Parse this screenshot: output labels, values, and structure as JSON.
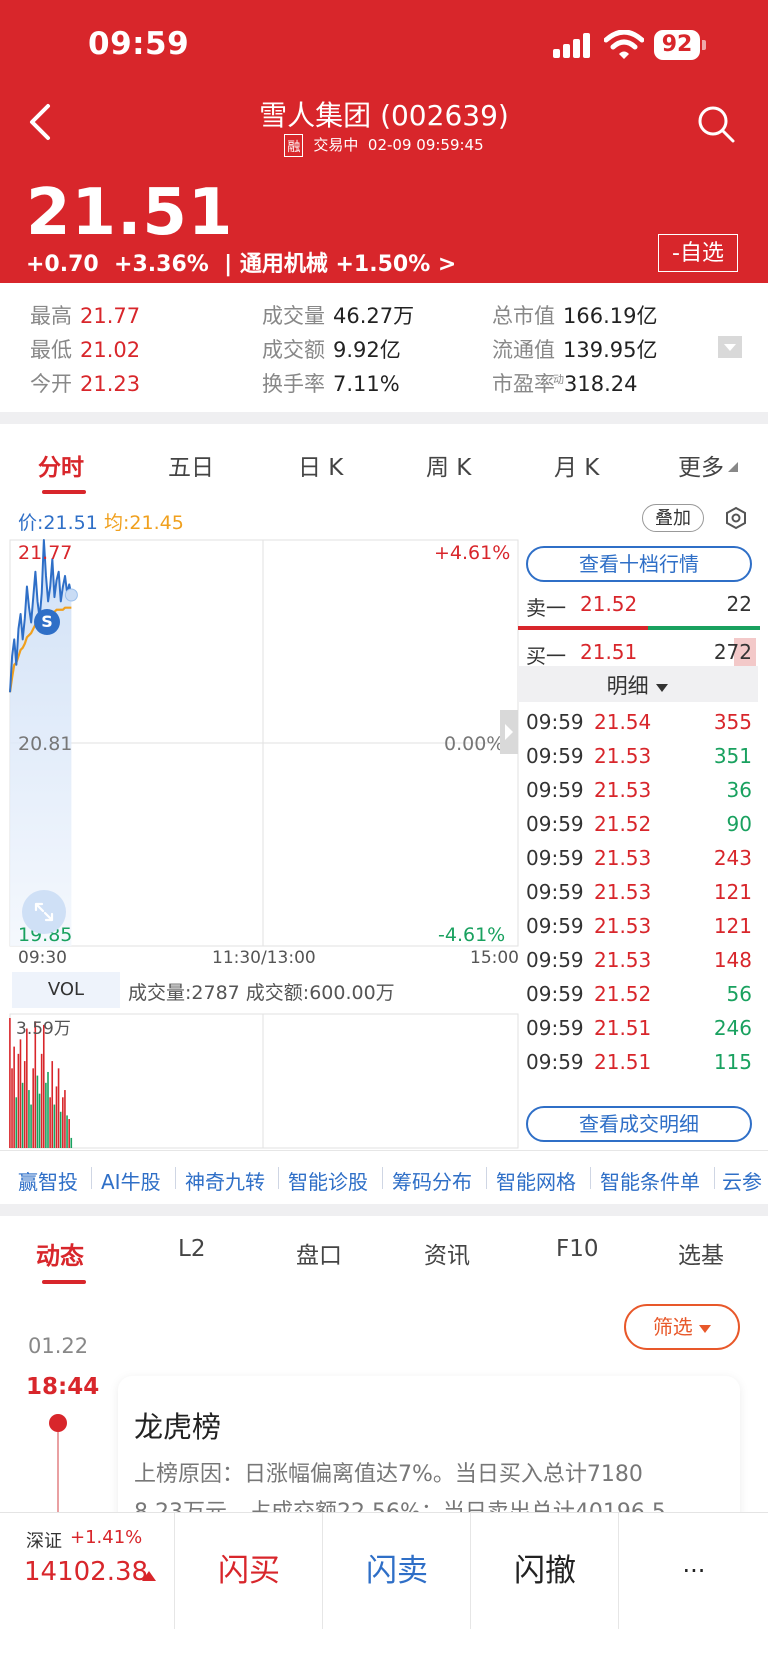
{
  "status_bar": {
    "time": "09:59",
    "battery": "92"
  },
  "header": {
    "title": "雪人集团 (002639)",
    "margin_tag": "融",
    "status": "交易中",
    "timestamp": "02-09 09:59:45",
    "price": "21.51",
    "change": "+0.70",
    "change_pct": "+3.36%",
    "sector": "| 通用机械 +1.50% >",
    "watchlist_label": "-自选"
  },
  "stats": {
    "high_label": "最高",
    "high": "21.77",
    "low_label": "最低",
    "low": "21.02",
    "open_label": "今开",
    "open": "21.23",
    "volume_label": "成交量",
    "volume": "46.27万",
    "amount_label": "成交额",
    "amount": "9.92亿",
    "turnover_label": "换手率",
    "turnover": "7.11%",
    "mktcap_label": "总市值",
    "mktcap": "166.19亿",
    "float_label": "流通值",
    "float": "139.95亿",
    "pe_label": "市盈率",
    "pe_mark": "动",
    "pe": "318.24"
  },
  "chart_tabs": [
    "分时",
    "五日",
    "日 K",
    "周 K",
    "月 K",
    "更多"
  ],
  "chart": {
    "price_label": "价:21.51",
    "avg_label": "均:21.45",
    "overlay_button": "叠加",
    "y_high": "21.77",
    "y_mid": "20.81",
    "y_low": "19.85",
    "pct_high": "+4.61%",
    "pct_mid": "0.00%",
    "pct_low": "-4.61%",
    "x_start": "09:30",
    "x_mid": "11:30/13:00",
    "x_end": "15:00",
    "s_marker": "S",
    "vol_tab": "VOL",
    "vol_info": "成交量:2787 成交额:600.00万",
    "vol_max": "3.59万"
  },
  "chart_data": {
    "type": "line",
    "title": "",
    "x": [
      "09:30",
      "09:31",
      "09:32",
      "09:33",
      "09:34",
      "09:35",
      "09:36",
      "09:37",
      "09:38",
      "09:39",
      "09:40",
      "09:41",
      "09:42",
      "09:43",
      "09:44",
      "09:45",
      "09:46",
      "09:47",
      "09:48",
      "09:49",
      "09:50",
      "09:51",
      "09:52",
      "09:53",
      "09:54",
      "09:55",
      "09:56",
      "09:57",
      "09:58",
      "09:59"
    ],
    "series": [
      {
        "name": "价",
        "values": [
          21.05,
          21.22,
          21.3,
          21.18,
          21.35,
          21.42,
          21.3,
          21.4,
          21.55,
          21.45,
          21.38,
          21.5,
          21.62,
          21.48,
          21.4,
          21.52,
          21.77,
          21.6,
          21.48,
          21.55,
          21.68,
          21.5,
          21.58,
          21.62,
          21.48,
          21.55,
          21.6,
          21.52,
          21.56,
          21.51
        ]
      },
      {
        "name": "均",
        "values": [
          21.05,
          21.12,
          21.18,
          21.19,
          21.22,
          21.25,
          21.26,
          21.28,
          21.31,
          21.32,
          21.33,
          21.35,
          21.37,
          21.38,
          21.38,
          21.39,
          21.41,
          21.42,
          21.42,
          21.43,
          21.43,
          21.43,
          21.44,
          21.44,
          21.44,
          21.44,
          21.45,
          21.45,
          21.45,
          21.45
        ]
      }
    ],
    "volume": [
      35900,
      22000,
      28000,
      14000,
      26000,
      30000,
      18000,
      24000,
      33000,
      16000,
      12000,
      22000,
      35000,
      20000,
      15000,
      26000,
      34000,
      18000,
      21000,
      14000,
      24000,
      12000,
      17000,
      22000,
      10000,
      14000,
      16000,
      9000,
      8000,
      2787
    ],
    "ylim": [
      19.85,
      21.77
    ],
    "x_range": [
      "09:30",
      "15:00"
    ]
  },
  "order_book": {
    "view_10_label": "查看十档行情",
    "sell1_label": "卖一",
    "sell1_price": "21.52",
    "sell1_vol": "22",
    "buy1_label": "买一",
    "buy1_price": "21.51",
    "buy1_vol": "272",
    "detail_label": "明细",
    "view_trades_label": "查看成交明细",
    "trades": [
      {
        "time": "09:59",
        "price": "21.54",
        "vol": "355",
        "dir": "up"
      },
      {
        "time": "09:59",
        "price": "21.53",
        "vol": "351",
        "dir": "down"
      },
      {
        "time": "09:59",
        "price": "21.53",
        "vol": "36",
        "dir": "down"
      },
      {
        "time": "09:59",
        "price": "21.52",
        "vol": "90",
        "dir": "down"
      },
      {
        "time": "09:59",
        "price": "21.53",
        "vol": "243",
        "dir": "up"
      },
      {
        "time": "09:59",
        "price": "21.53",
        "vol": "121",
        "dir": "up"
      },
      {
        "time": "09:59",
        "price": "21.53",
        "vol": "121",
        "dir": "up"
      },
      {
        "time": "09:59",
        "price": "21.53",
        "vol": "148",
        "dir": "up"
      },
      {
        "time": "09:59",
        "price": "21.52",
        "vol": "56",
        "dir": "down"
      },
      {
        "time": "09:59",
        "price": "21.51",
        "vol": "246",
        "dir": "down"
      },
      {
        "time": "09:59",
        "price": "21.51",
        "vol": "115",
        "dir": "down"
      }
    ]
  },
  "features": [
    "赢智投",
    "AI牛股",
    "神奇九转",
    "智能诊股",
    "筹码分布",
    "智能网格",
    "智能条件单",
    "云参"
  ],
  "news_tabs": [
    "动态",
    "L2",
    "盘口",
    "资讯",
    "F10",
    "选基"
  ],
  "timeline": {
    "filter_label": "筛选",
    "date": "01.22",
    "time": "18:44",
    "card_title": "龙虎榜",
    "card_line1": "上榜原因：日涨幅偏离值达7%。当日买入总计7180",
    "card_line2": "8.23万元，占成交额22.56%；当日卖出总计40196.5"
  },
  "bottom": {
    "index_name": "深证",
    "index_chg": "+1.41%",
    "index_value": "14102.38",
    "flash_buy": "闪买",
    "flash_sell": "闪卖",
    "flash_cancel": "闪撤",
    "more": "···"
  },
  "colors": {
    "brand_red": "#d8262b",
    "up": "#d8262b",
    "down": "#19a15f",
    "link_blue": "#2f6fc7",
    "avg_orange": "#f0a01e"
  }
}
